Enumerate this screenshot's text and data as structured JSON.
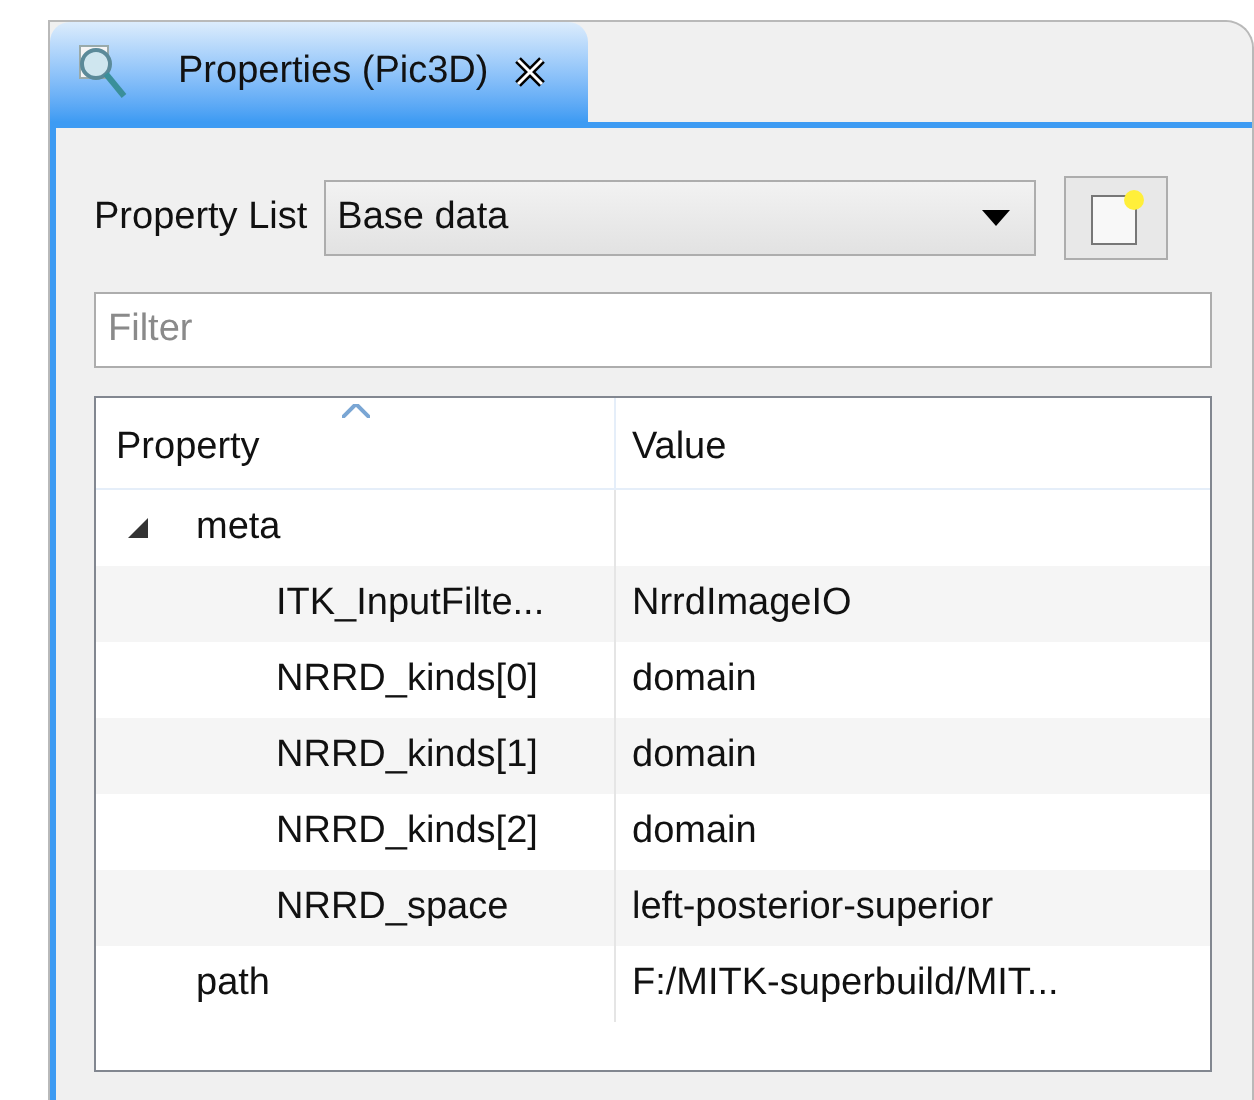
{
  "tab": {
    "title": "Properties (Pic3D)",
    "selected": true
  },
  "property_list": {
    "label": "Property List",
    "value": "Base data"
  },
  "filter": {
    "placeholder": "Filter"
  },
  "table": {
    "columns": [
      {
        "label": "Property",
        "sorted": true
      },
      {
        "label": "Value",
        "sorted": false
      }
    ],
    "rows": [
      {
        "property": "meta",
        "value": "",
        "expanded": true,
        "children": [
          {
            "property": "ITK_InputFilte...",
            "value": "NrrdImageIO"
          },
          {
            "property": "NRRD_kinds[0]",
            "value": "domain"
          },
          {
            "property": "NRRD_kinds[1]",
            "value": "domain"
          },
          {
            "property": "NRRD_kinds[2]",
            "value": "domain"
          },
          {
            "property": "NRRD_space",
            "value": "left-posterior-superior"
          }
        ]
      },
      {
        "property": "path",
        "value": "F:/MITK-superbuild/MIT..."
      }
    ]
  }
}
